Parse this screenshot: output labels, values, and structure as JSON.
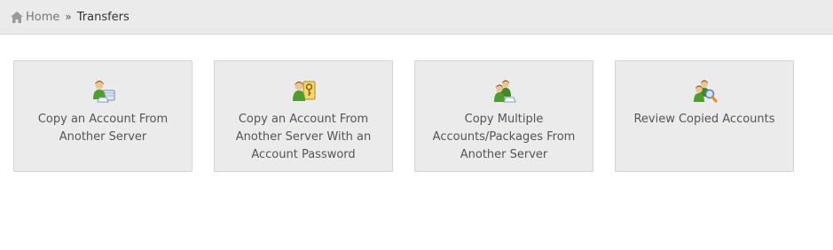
{
  "breadcrumb": {
    "home_label": "Home",
    "separator": "»",
    "current_label": "Transfers"
  },
  "tiles": [
    {
      "label": "Copy an Account From Another Server",
      "icon": "user-copy-icon"
    },
    {
      "label": "Copy an Account From Another Server With an Account Password",
      "icon": "user-key-icon"
    },
    {
      "label": "Copy Multiple Accounts/Packages From Another Server",
      "icon": "users-copy-icon"
    },
    {
      "label": "Review Copied Accounts",
      "icon": "users-review-icon"
    }
  ],
  "colors": {
    "breadcrumb_bg": "#ebebeb",
    "tile_bg": "#ebebeb",
    "tile_border": "#d3d3d3",
    "text": "#555555"
  }
}
